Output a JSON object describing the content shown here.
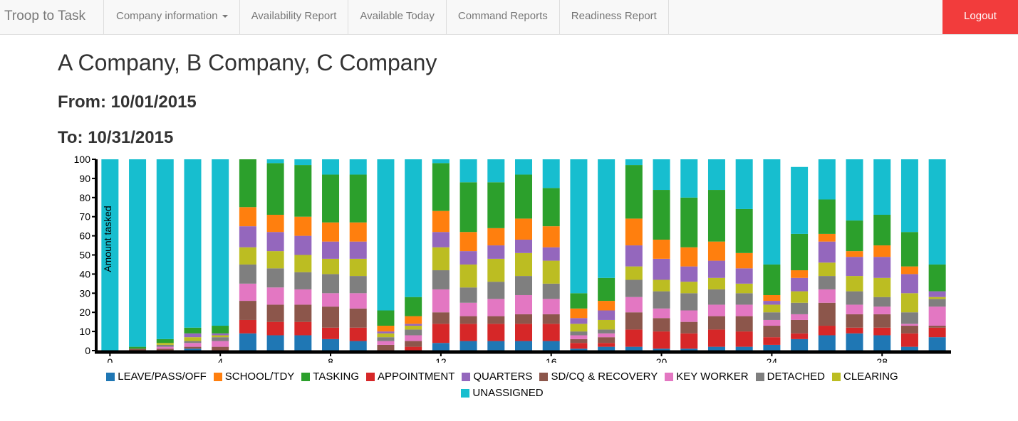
{
  "navbar": {
    "brand": "Troop to Task",
    "items": [
      "Company information",
      "Availability Report",
      "Available Today",
      "Command Reports",
      "Readiness Report"
    ],
    "logout": "Logout"
  },
  "heading": {
    "title": "A Company, B Company, C Company",
    "from": "From: 10/01/2015",
    "to": "To: 10/31/2015"
  },
  "chart_data": {
    "type": "bar",
    "stacked": true,
    "ylabel": "Amount tasked",
    "xlabel": "",
    "ylim": [
      0,
      100
    ],
    "yticks": [
      0,
      10,
      20,
      30,
      40,
      50,
      60,
      70,
      80,
      90,
      100
    ],
    "xlim": [
      0,
      31
    ],
    "xticks": [
      0,
      4,
      8,
      12,
      16,
      20,
      24,
      28
    ],
    "x": [
      0,
      1,
      2,
      3,
      4,
      5,
      6,
      7,
      8,
      9,
      10,
      11,
      12,
      13,
      14,
      15,
      16,
      17,
      18,
      19,
      20,
      21,
      22,
      23,
      24,
      25,
      26,
      27,
      28,
      29,
      30
    ],
    "legend_position": "bottom",
    "series": [
      {
        "name": "LEAVE/PASS/OFF",
        "color": "#1f77b4",
        "values": [
          0,
          0,
          0,
          1,
          0,
          9,
          8,
          8,
          6,
          5,
          0,
          0,
          4,
          5,
          5,
          5,
          5,
          1,
          2,
          2,
          1,
          1,
          2,
          2,
          3,
          6,
          8,
          9,
          8,
          2,
          7
        ]
      },
      {
        "name": "APPOINTMENT",
        "color": "#d62728",
        "values": [
          0,
          0,
          0,
          0,
          0,
          7,
          7,
          7,
          6,
          7,
          0,
          2,
          10,
          9,
          9,
          9,
          9,
          3,
          2,
          9,
          9,
          8,
          9,
          8,
          4,
          3,
          5,
          3,
          4,
          7,
          5
        ]
      },
      {
        "name": "SD/CQ & RECOVERY",
        "color": "#8c564b",
        "values": [
          0,
          1,
          1,
          1,
          2,
          10,
          9,
          9,
          11,
          10,
          3,
          3,
          6,
          4,
          4,
          5,
          5,
          2,
          3,
          9,
          7,
          6,
          7,
          8,
          6,
          7,
          12,
          7,
          7,
          4,
          1
        ]
      },
      {
        "name": "KEY WORKER",
        "color": "#e377c2",
        "values": [
          0,
          0,
          1,
          2,
          3,
          9,
          9,
          8,
          7,
          8,
          2,
          3,
          12,
          7,
          9,
          10,
          8,
          2,
          2,
          8,
          5,
          6,
          6,
          6,
          3,
          3,
          7,
          5,
          4,
          1,
          10
        ]
      },
      {
        "name": "DETACHED",
        "color": "#7f7f7f",
        "values": [
          0,
          0,
          1,
          1,
          2,
          10,
          10,
          9,
          10,
          9,
          2,
          3,
          10,
          8,
          9,
          10,
          8,
          2,
          2,
          9,
          9,
          9,
          8,
          6,
          4,
          6,
          7,
          7,
          5,
          6,
          4
        ]
      },
      {
        "name": "CLEARING",
        "color": "#bcbd22",
        "values": [
          0,
          0,
          1,
          2,
          1,
          9,
          9,
          9,
          8,
          9,
          2,
          2,
          12,
          12,
          12,
          12,
          12,
          4,
          5,
          7,
          6,
          6,
          6,
          5,
          4,
          6,
          7,
          8,
          10,
          10,
          1
        ]
      },
      {
        "name": "QUARTERS",
        "color": "#9467bd",
        "values": [
          0,
          0,
          0,
          2,
          1,
          11,
          10,
          10,
          9,
          9,
          1,
          1,
          8,
          7,
          7,
          7,
          7,
          3,
          5,
          11,
          11,
          8,
          9,
          8,
          2,
          7,
          11,
          10,
          11,
          10,
          3
        ]
      },
      {
        "name": "SCHOOL/TDY",
        "color": "#ff7f0e",
        "values": [
          0,
          0,
          0,
          0,
          0,
          10,
          9,
          10,
          10,
          10,
          3,
          4,
          11,
          10,
          9,
          11,
          11,
          5,
          5,
          14,
          10,
          10,
          10,
          8,
          3,
          4,
          4,
          3,
          6,
          4,
          0
        ]
      },
      {
        "name": "TASKING",
        "color": "#2ca02c",
        "values": [
          0,
          1,
          2,
          3,
          4,
          25,
          27,
          27,
          25,
          25,
          8,
          10,
          25,
          26,
          24,
          23,
          20,
          8,
          12,
          28,
          26,
          26,
          27,
          23,
          16,
          19,
          18,
          16,
          16,
          18,
          14
        ]
      },
      {
        "name": "UNASSIGNED",
        "color": "#17becf",
        "values": [
          100,
          98,
          94,
          88,
          87,
          0,
          2,
          3,
          8,
          8,
          79,
          72,
          2,
          12,
          12,
          8,
          15,
          70,
          62,
          3,
          16,
          20,
          16,
          26,
          55,
          35,
          21,
          32,
          29,
          38,
          55
        ]
      }
    ],
    "legend": [
      "LEAVE/PASS/OFF",
      "SCHOOL/TDY",
      "TASKING",
      "APPOINTMENT",
      "QUARTERS",
      "SD/CQ & RECOVERY",
      "KEY WORKER",
      "DETACHED",
      "CLEARING",
      "UNASSIGNED"
    ],
    "grid": false
  }
}
